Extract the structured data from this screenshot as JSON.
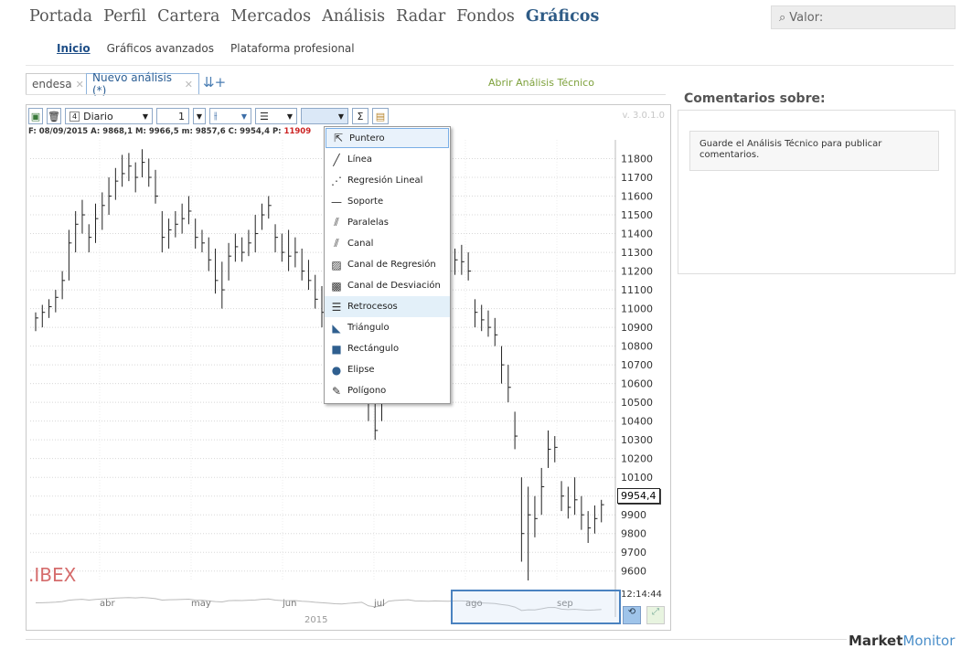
{
  "topnav": [
    "Portada",
    "Perfil",
    "Cartera",
    "Mercados",
    "Análisis",
    "Radar",
    "Fondos",
    "Gráficos"
  ],
  "topnav_active": "Gráficos",
  "search": {
    "placeholder": "Valor:"
  },
  "subnav": [
    "Inicio",
    "Gráficos avanzados",
    "Plataforma profesional"
  ],
  "tabs": [
    {
      "label": "endesa"
    },
    {
      "label": "Nuevo análisis (*)"
    }
  ],
  "abrir_link": "Abrir Análisis Técnico",
  "toolbar": {
    "period_num": "4",
    "period": "Diario",
    "count": "1",
    "version": "v. 3.0.1.0"
  },
  "infoline": {
    "prefix": "F: 08/09/2015 A: 9868,1 M: 9966,5 m: 9857,6 C: 9954,4 P: ",
    "p_val": "11909"
  },
  "instrument": ".IBEX",
  "last_price": "9954,4",
  "clock": "12:14:44",
  "drawing_menu": [
    "Puntero",
    "Línea",
    "Regresión Lineal",
    "Soporte",
    "Paralelas",
    "Canal",
    "Canal de Regresión",
    "Canal de Desviación",
    "Retrocesos",
    "Triángulo",
    "Rectángulo",
    "Elipse",
    "Polígono"
  ],
  "comentarios": {
    "title": "Comentarios sobre:",
    "note": "Guarde el Análisis Técnico para publicar comentarios."
  },
  "brand": {
    "a": "Market",
    "b": "Monitor"
  },
  "nav_year": "2015",
  "chart_data": {
    "type": "bar",
    "title": ".IBEX",
    "y_ticks": [
      11800,
      11700,
      11600,
      11500,
      11400,
      11300,
      11200,
      11100,
      11000,
      10900,
      10800,
      10700,
      10600,
      10500,
      10400,
      10300,
      10200,
      10100,
      10000,
      9900,
      9800,
      9700,
      9600
    ],
    "ylim": [
      9550,
      11900
    ],
    "x_months": [
      "abr",
      "may",
      "jun",
      "jul",
      "ago",
      "sep"
    ],
    "ohlc": [
      [
        10980,
        10880,
        10950
      ],
      [
        11020,
        10900,
        10980
      ],
      [
        11050,
        10950,
        11010
      ],
      [
        11100,
        10980,
        11060
      ],
      [
        11200,
        11050,
        11150
      ],
      [
        11420,
        11150,
        11350
      ],
      [
        11520,
        11300,
        11450
      ],
      [
        11580,
        11400,
        11500
      ],
      [
        11450,
        11300,
        11380
      ],
      [
        11560,
        11350,
        11480
      ],
      [
        11620,
        11420,
        11550
      ],
      [
        11700,
        11500,
        11600
      ],
      [
        11750,
        11580,
        11680
      ],
      [
        11820,
        11650,
        11720
      ],
      [
        11830,
        11680,
        11760
      ],
      [
        11780,
        11620,
        11700
      ],
      [
        11850,
        11700,
        11780
      ],
      [
        11800,
        11650,
        11700
      ],
      [
        11740,
        11560,
        11600
      ],
      [
        11520,
        11300,
        11380
      ],
      [
        11480,
        11320,
        11420
      ],
      [
        11520,
        11380,
        11450
      ],
      [
        11560,
        11400,
        11480
      ],
      [
        11600,
        11450,
        11520
      ],
      [
        11480,
        11320,
        11380
      ],
      [
        11420,
        11300,
        11350
      ],
      [
        11380,
        11200,
        11260
      ],
      [
        11320,
        11080,
        11150
      ],
      [
        11250,
        11000,
        11100
      ],
      [
        11350,
        11150,
        11280
      ],
      [
        11400,
        11250,
        11330
      ],
      [
        11380,
        11250,
        11300
      ],
      [
        11420,
        11280,
        11350
      ],
      [
        11500,
        11300,
        11400
      ],
      [
        11560,
        11420,
        11500
      ],
      [
        11600,
        11480,
        11550
      ],
      [
        11450,
        11300,
        11380
      ],
      [
        11400,
        11250,
        11300
      ],
      [
        11420,
        11200,
        11280
      ],
      [
        11380,
        11220,
        11300
      ],
      [
        11320,
        11150,
        11200
      ],
      [
        11260,
        11100,
        11150
      ],
      [
        11180,
        11000,
        11050
      ],
      [
        11120,
        10900,
        10980
      ],
      [
        11050,
        10850,
        10900
      ],
      [
        11000,
        10750,
        10820
      ],
      [
        10900,
        10700,
        10780
      ],
      [
        10950,
        10800,
        10880
      ],
      [
        11020,
        10860,
        10960
      ],
      [
        11100,
        10950,
        11050
      ],
      [
        10700,
        10400,
        10500
      ],
      [
        10550,
        10300,
        10350
      ],
      [
        10600,
        10400,
        10500
      ],
      [
        11300,
        11100,
        11200
      ],
      [
        11400,
        11250,
        11330
      ],
      [
        11450,
        11300,
        11380
      ],
      [
        11500,
        11380,
        11430
      ],
      [
        11380,
        11200,
        11260
      ],
      [
        11300,
        11150,
        11230
      ],
      [
        11260,
        11120,
        11200
      ],
      [
        11320,
        11160,
        11250
      ],
      [
        11300,
        11150,
        11220
      ],
      [
        11280,
        11120,
        11200
      ],
      [
        11320,
        11180,
        11260
      ],
      [
        11340,
        11180,
        11250
      ],
      [
        11300,
        11150,
        11200
      ],
      [
        11050,
        10900,
        10980
      ],
      [
        11020,
        10880,
        10940
      ],
      [
        10990,
        10850,
        10900
      ],
      [
        10950,
        10800,
        10860
      ],
      [
        10800,
        10600,
        10700
      ],
      [
        10700,
        10500,
        10580
      ],
      [
        10450,
        10250,
        10320
      ],
      [
        10100,
        9650,
        9800
      ],
      [
        10050,
        9550,
        9900
      ],
      [
        10000,
        9780,
        9880
      ],
      [
        10150,
        9900,
        10050
      ],
      [
        10350,
        10150,
        10250
      ],
      [
        10320,
        10180,
        10260
      ],
      [
        10080,
        9920,
        10000
      ],
      [
        10050,
        9880,
        9940
      ],
      [
        10100,
        9900,
        9980
      ],
      [
        10000,
        9820,
        9900
      ],
      [
        9920,
        9750,
        9830
      ],
      [
        9950,
        9800,
        9880
      ],
      [
        9980,
        9860,
        9954
      ]
    ]
  }
}
